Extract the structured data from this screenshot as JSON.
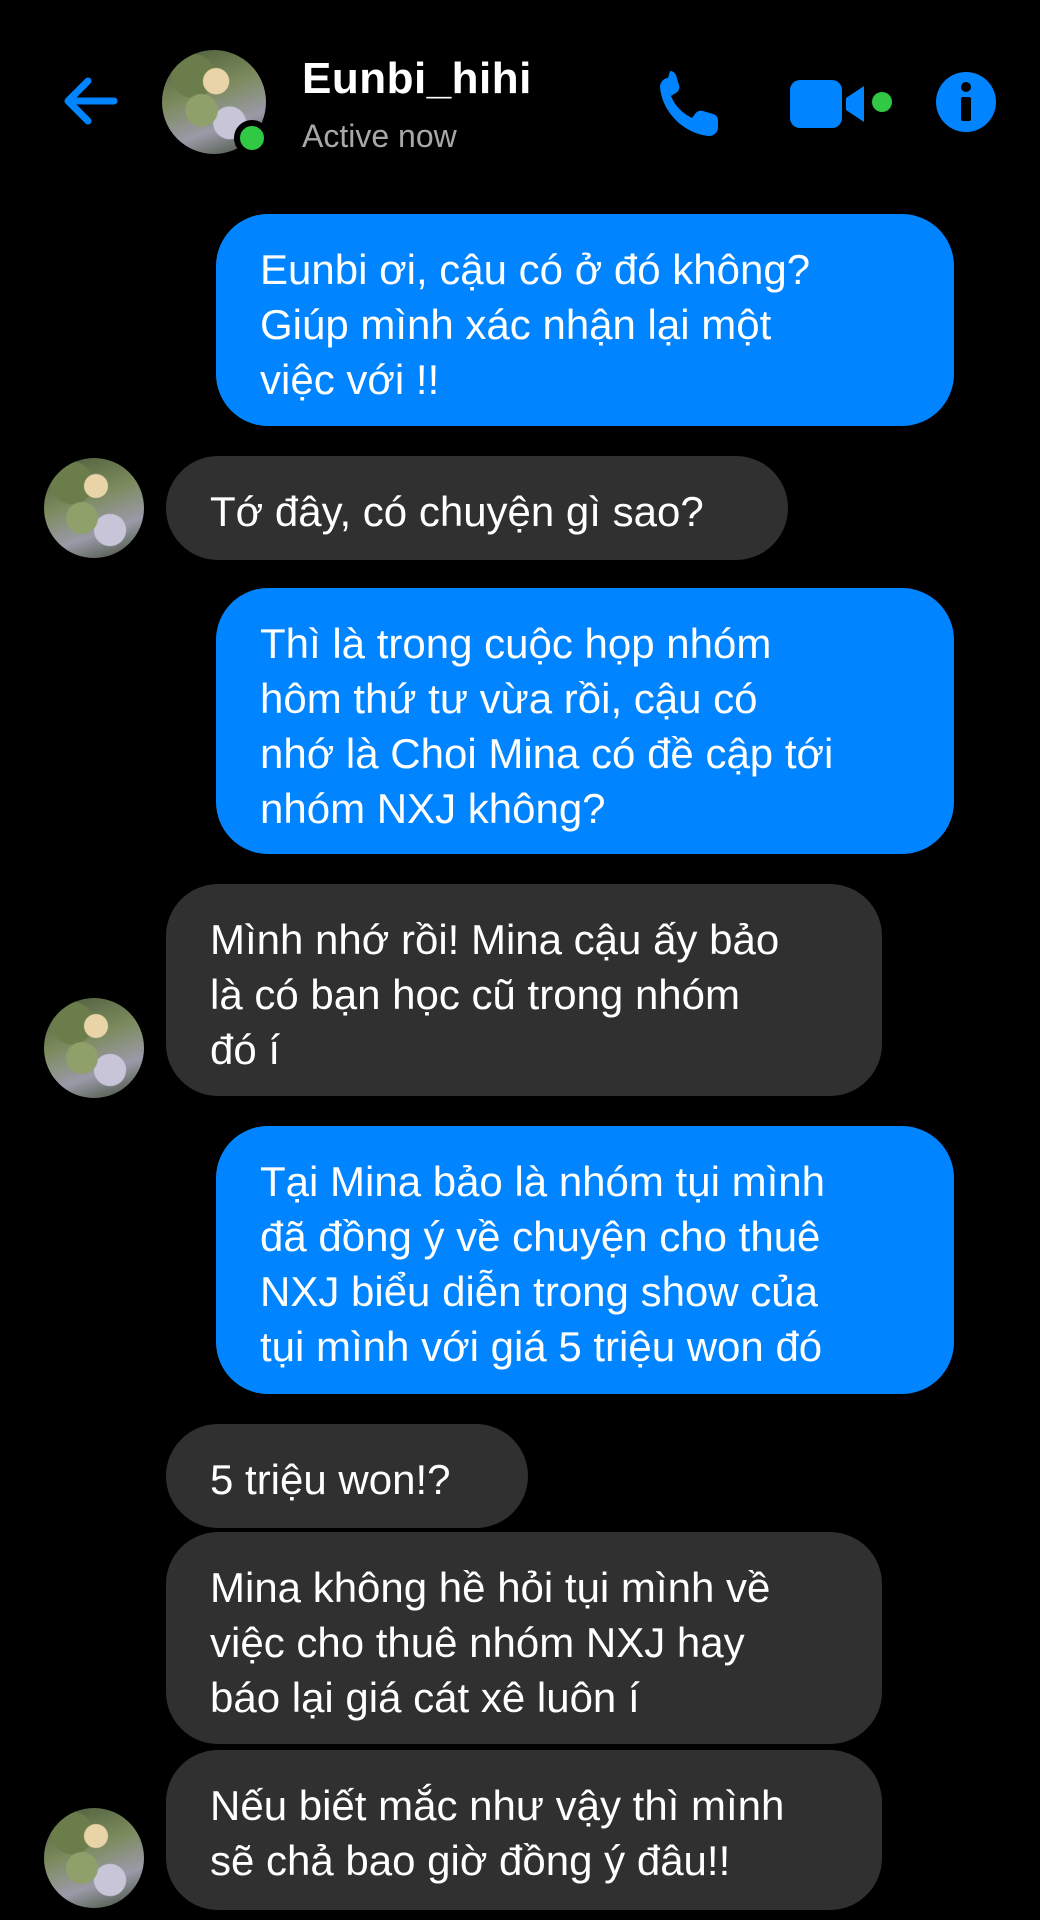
{
  "header": {
    "contact_name": "Eunbi_hihi",
    "status": "Active now",
    "icons": {
      "back": "arrow-left-icon",
      "call": "phone-icon",
      "video": "video-camera-icon",
      "info": "info-icon"
    },
    "colors": {
      "accent": "#0084ff",
      "presence": "#31c844"
    }
  },
  "messages": [
    {
      "direction": "outgoing",
      "text": "Eunbi ơi, cậu có ở đó không?\nGiúp mình xác nhận lại một\nviệc với !!"
    },
    {
      "direction": "incoming",
      "text": "Tớ đây, có chuyện gì sao?"
    },
    {
      "direction": "outgoing",
      "text": "Thì là trong cuộc họp nhóm\nhôm thứ tư vừa rồi, cậu có\nnhớ là Choi Mina có đề cập tới\nnhóm NXJ không?"
    },
    {
      "direction": "incoming",
      "text": "Mình nhớ rồi! Mina cậu ấy bảo\nlà có bạn học cũ trong nhóm\nđó í"
    },
    {
      "direction": "outgoing",
      "text": "Tại Mina bảo là nhóm tụi mình\nđã đồng ý về chuyện cho thuê\nNXJ biểu diễn trong show của\ntụi mình với giá 5 triệu won đó"
    },
    {
      "direction": "incoming",
      "text": "5 triệu won!?"
    },
    {
      "direction": "incoming",
      "text": "Mina không hề hỏi tụi mình về\nviệc cho thuê nhóm NXJ hay\nbáo lại giá cát xê luôn í"
    },
    {
      "direction": "incoming",
      "text": "Nếu biết mắc như vậy thì mình\nsẽ chả bao giờ đồng ý đâu!!"
    }
  ],
  "colors": {
    "background": "#000000",
    "outgoing_bubble": "#0084ff",
    "incoming_bubble": "#303030",
    "text": "#ffffff",
    "secondary_text": "#a8a8a8"
  }
}
